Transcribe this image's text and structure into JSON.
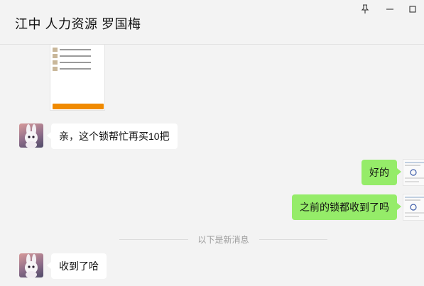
{
  "window": {
    "title": "江中 人力资源 罗国梅"
  },
  "divider": {
    "text": "以下是新消息"
  },
  "messages": [
    {
      "sender": "other",
      "text": "亲，这个锁帮忙再买10把"
    },
    {
      "sender": "self",
      "text": "好的"
    },
    {
      "sender": "self",
      "text": "之前的锁都收到了吗"
    },
    {
      "sender": "other",
      "text": "收到了哈"
    }
  ],
  "colors": {
    "background": "#f3f3f3",
    "self_bubble": "#95ec69",
    "other_bubble": "#ffffff",
    "card_button": "#f08a00"
  }
}
